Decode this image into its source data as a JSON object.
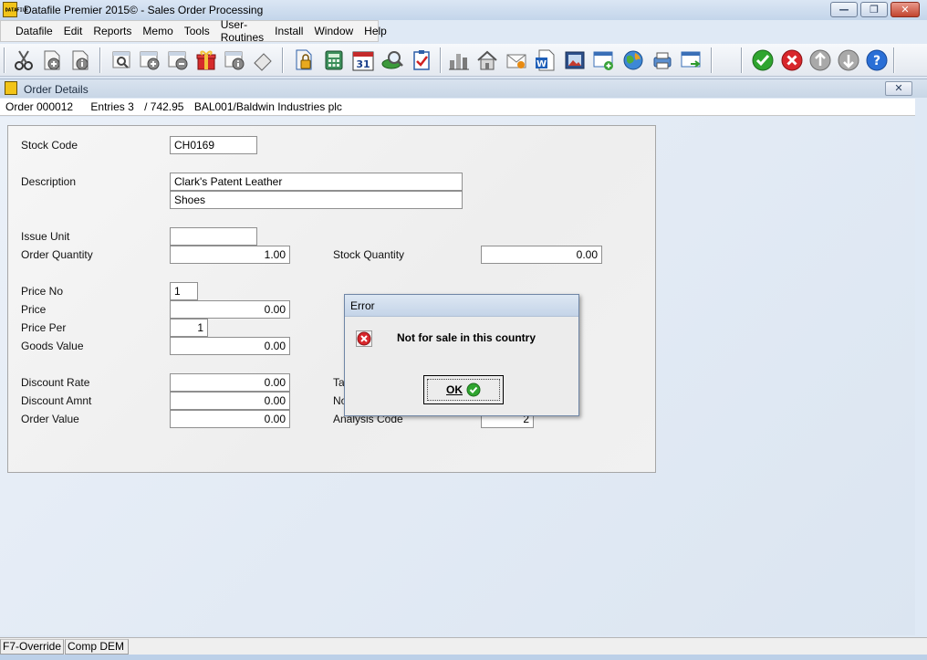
{
  "window": {
    "title": "Datafile  Premier 2015©  - Sales Order Processing",
    "app_icon_text": "DATAFILE",
    "minimize_label": "—",
    "restore_label": "❐",
    "close_label": "✕"
  },
  "menu": {
    "items": [
      "Datafile",
      "Edit",
      "Reports",
      "Memo",
      "Tools",
      "User-Routines",
      "Install",
      "Window",
      "Help"
    ]
  },
  "toolbar": {
    "icons": [
      "scissors-icon",
      "new-document-icon",
      "document-info-icon",
      "find-icon",
      "add-record-icon",
      "delete-record-icon",
      "gift-icon",
      "record-info-icon",
      "eraser-icon",
      "lock-document-icon",
      "calculator-icon",
      "calendar-icon",
      "search-globe-icon",
      "checklist-icon",
      "bar-chart-icon",
      "home-icon",
      "email-icon",
      "word-icon",
      "picture-icon",
      "add-window-icon",
      "globe-icon",
      "printer-icon",
      "export-icon",
      "accept-icon",
      "cancel-icon",
      "arrow-up-icon",
      "arrow-down-icon",
      "help-icon"
    ],
    "calendar_day": "31",
    "word_letter": "W"
  },
  "child_window": {
    "title": "Order Details",
    "close_label": "✕"
  },
  "order_line": {
    "order": "Order 000012",
    "entries": "Entries 3",
    "total": "/ 742.95",
    "customer": "BAL001/Baldwin Industries plc"
  },
  "form": {
    "stock_code": {
      "label": "Stock Code",
      "value": "CH0169"
    },
    "description": {
      "label": "Description",
      "line1": "Clark's Patent Leather",
      "line2": "Shoes"
    },
    "issue_unit": {
      "label": "Issue Unit",
      "value": ""
    },
    "order_quantity": {
      "label": "Order Quantity",
      "value": "1.00"
    },
    "stock_quantity": {
      "label": "Stock Quantity",
      "value": "0.00"
    },
    "price_no": {
      "label": "Price No",
      "value": "1"
    },
    "price": {
      "label": "Price",
      "value": "0.00"
    },
    "price_per": {
      "label": "Price Per",
      "value": "1"
    },
    "goods_value": {
      "label": "Goods Value",
      "value": "0.00"
    },
    "discount_rate": {
      "label": "Discount Rate",
      "value": "0.00"
    },
    "discount_amnt": {
      "label": "Discount Amnt",
      "value": "0.00"
    },
    "order_value": {
      "label": "Order Value",
      "value": "0.00"
    },
    "tax_label_partial": "Ta",
    "nominal_label_partial": "No",
    "analysis_code": {
      "label": "Analysis Code",
      "value": "2"
    }
  },
  "dialog": {
    "title": "Error",
    "message": "Not for sale in this country",
    "ok_label": "OK"
  },
  "status": {
    "f7": "F7-Override",
    "company": "Comp DEM"
  },
  "colors": {
    "accept": "#2fa52f",
    "cancel": "#d8262b",
    "help": "#2a6fd6"
  }
}
